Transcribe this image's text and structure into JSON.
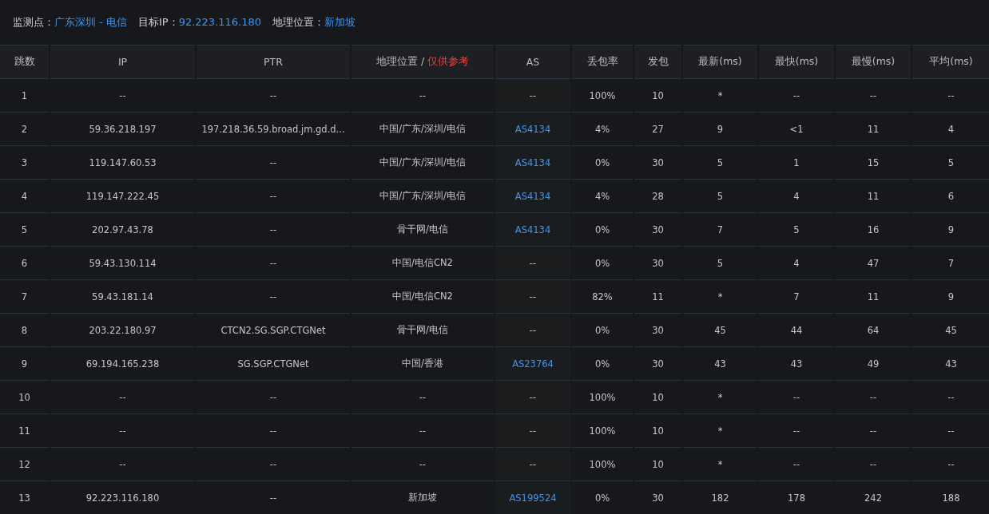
{
  "info": [
    {
      "label": "监测点：",
      "value": "广东深圳 - 电信"
    },
    {
      "label": "目标IP：",
      "value": "92.223.116.180"
    },
    {
      "label": "地理位置：",
      "value": "新加坡"
    }
  ],
  "columns": [
    {
      "label": "跳数"
    },
    {
      "label": "IP"
    },
    {
      "label": "PTR"
    },
    {
      "label": "地理位置 / ",
      "note": "仅供参考"
    },
    {
      "label": "AS"
    },
    {
      "label": "丢包率"
    },
    {
      "label": "发包"
    },
    {
      "label": "最新(ms)"
    },
    {
      "label": "最快(ms)"
    },
    {
      "label": "最慢(ms)"
    },
    {
      "label": "平均(ms)"
    }
  ],
  "rows": [
    {
      "hop": "1",
      "ip": "--",
      "ptr": "--",
      "geo": "--",
      "as": "--",
      "as_link": false,
      "loss": "100%",
      "sent": "10",
      "last": "*",
      "best": "--",
      "worst": "--",
      "avg": "--"
    },
    {
      "hop": "2",
      "ip": "59.36.218.197",
      "ptr": "197.218.36.59.broad.jm.gd.d...",
      "geo": "中国/广东/深圳/电信",
      "as": "AS4134",
      "as_link": true,
      "loss": "4%",
      "sent": "27",
      "last": "9",
      "best": "<1",
      "worst": "11",
      "avg": "4"
    },
    {
      "hop": "3",
      "ip": "119.147.60.53",
      "ptr": "--",
      "geo": "中国/广东/深圳/电信",
      "as": "AS4134",
      "as_link": true,
      "loss": "0%",
      "sent": "30",
      "last": "5",
      "best": "1",
      "worst": "15",
      "avg": "5"
    },
    {
      "hop": "4",
      "ip": "119.147.222.45",
      "ptr": "--",
      "geo": "中国/广东/深圳/电信",
      "as": "AS4134",
      "as_link": true,
      "loss": "4%",
      "sent": "28",
      "last": "5",
      "best": "4",
      "worst": "11",
      "avg": "6"
    },
    {
      "hop": "5",
      "ip": "202.97.43.78",
      "ptr": "--",
      "geo": "骨干网/电信",
      "as": "AS4134",
      "as_link": true,
      "loss": "0%",
      "sent": "30",
      "last": "7",
      "best": "5",
      "worst": "16",
      "avg": "9"
    },
    {
      "hop": "6",
      "ip": "59.43.130.114",
      "ptr": "--",
      "geo": "中国/电信CN2",
      "as": "--",
      "as_link": false,
      "loss": "0%",
      "sent": "30",
      "last": "5",
      "best": "4",
      "worst": "47",
      "avg": "7"
    },
    {
      "hop": "7",
      "ip": "59.43.181.14",
      "ptr": "--",
      "geo": "中国/电信CN2",
      "as": "--",
      "as_link": false,
      "loss": "82%",
      "sent": "11",
      "last": "*",
      "best": "7",
      "worst": "11",
      "avg": "9"
    },
    {
      "hop": "8",
      "ip": "203.22.180.97",
      "ptr": "CTCN2.SG.SGP.CTGNet",
      "geo": "骨干网/电信",
      "as": "--",
      "as_link": false,
      "loss": "0%",
      "sent": "30",
      "last": "45",
      "best": "44",
      "worst": "64",
      "avg": "45"
    },
    {
      "hop": "9",
      "ip": "69.194.165.238",
      "ptr": "SG.SGP.CTGNet",
      "geo": "中国/香港",
      "as": "AS23764",
      "as_link": true,
      "loss": "0%",
      "sent": "30",
      "last": "43",
      "best": "43",
      "worst": "49",
      "avg": "43"
    },
    {
      "hop": "10",
      "ip": "--",
      "ptr": "--",
      "geo": "--",
      "as": "--",
      "as_link": false,
      "loss": "100%",
      "sent": "10",
      "last": "*",
      "best": "--",
      "worst": "--",
      "avg": "--"
    },
    {
      "hop": "11",
      "ip": "--",
      "ptr": "--",
      "geo": "--",
      "as": "--",
      "as_link": false,
      "loss": "100%",
      "sent": "10",
      "last": "*",
      "best": "--",
      "worst": "--",
      "avg": "--"
    },
    {
      "hop": "12",
      "ip": "--",
      "ptr": "--",
      "geo": "--",
      "as": "--",
      "as_link": false,
      "loss": "100%",
      "sent": "10",
      "last": "*",
      "best": "--",
      "worst": "--",
      "avg": "--"
    },
    {
      "hop": "13",
      "ip": "92.223.116.180",
      "ptr": "--",
      "geo": "新加坡",
      "as": "AS199524",
      "as_link": true,
      "loss": "0%",
      "sent": "30",
      "last": "182",
      "best": "178",
      "worst": "242",
      "avg": "188"
    }
  ]
}
